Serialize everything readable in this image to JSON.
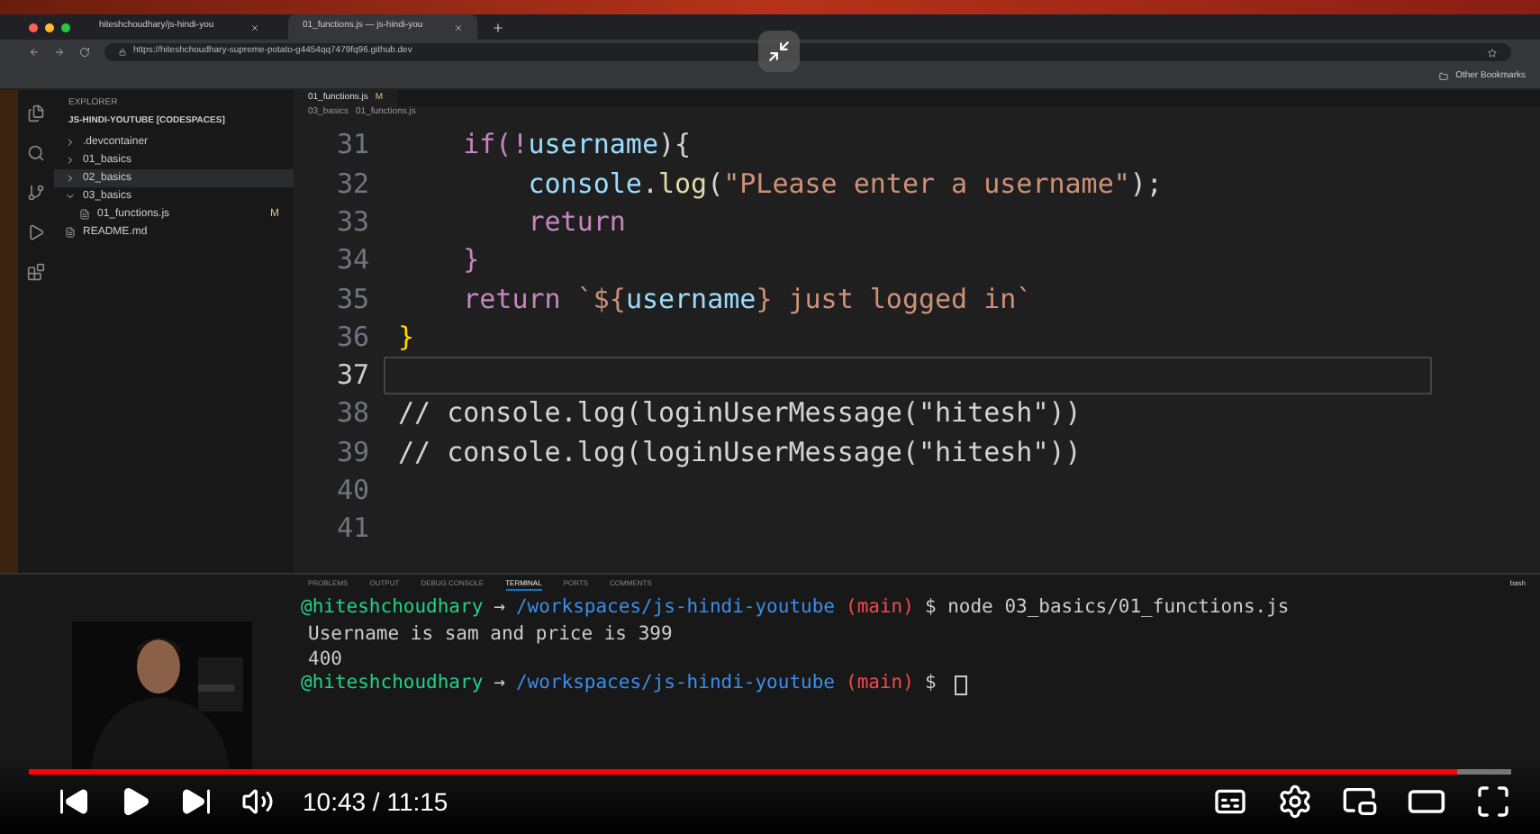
{
  "browser": {
    "tabs": [
      {
        "label": "hiteshchoudhary/js-hindi-you",
        "selected": false
      },
      {
        "label": "01_functions.js — js-hindi-you",
        "selected": true
      }
    ],
    "url": "https://hiteshchoudhary-supreme-potato-g4454qq7479fq96.github.dev",
    "bookmark": "Other Bookmarks"
  },
  "sidebar": {
    "title": "EXPLORER",
    "root": "JS-HINDI-YOUTUBE [CODESPACES]",
    "items": [
      {
        "label": ".devcontainer",
        "kind": "folder",
        "expanded": false,
        "selected": false
      },
      {
        "label": "01_basics",
        "kind": "folder",
        "expanded": false,
        "selected": false
      },
      {
        "label": "02_basics",
        "kind": "folder",
        "expanded": false,
        "selected": true
      },
      {
        "label": "03_basics",
        "kind": "folder",
        "expanded": true,
        "selected": false,
        "children": [
          {
            "label": "01_functions.js",
            "kind": "file",
            "badge": "M",
            "selected": false
          }
        ]
      },
      {
        "label": "README.md",
        "kind": "file",
        "selected": false
      }
    ]
  },
  "editor": {
    "tab": {
      "label": "01_functions.js",
      "badge": "M"
    },
    "breadcrumb": [
      "03_basics",
      "01_functions.js"
    ],
    "lines": [
      {
        "number": "31",
        "current": false,
        "tokens": [
          {
            "text": "    if(!",
            "kind": "keyword"
          },
          {
            "text": "username",
            "kind": "var"
          },
          {
            "text": "){",
            "kind": "plain"
          }
        ]
      },
      {
        "number": "32",
        "current": false,
        "tokens": [
          {
            "text": "        console",
            "kind": "var"
          },
          {
            "text": ".",
            "kind": "plain"
          },
          {
            "text": "log",
            "kind": "fn"
          },
          {
            "text": "(",
            "kind": "plain"
          },
          {
            "text": "\"PLease enter a username\"",
            "kind": "string"
          },
          {
            "text": ");",
            "kind": "plain"
          }
        ]
      },
      {
        "number": "33",
        "current": false,
        "tokens": [
          {
            "text": "        return",
            "kind": "keyword"
          }
        ]
      },
      {
        "number": "34",
        "current": false,
        "tokens": [
          {
            "text": "    }",
            "kind": "keyword"
          }
        ]
      },
      {
        "number": "35",
        "current": false,
        "tokens": [
          {
            "text": "    return ",
            "kind": "keyword"
          },
          {
            "text": "`${",
            "kind": "string"
          },
          {
            "text": "username",
            "kind": "var"
          },
          {
            "text": "} just logged in`",
            "kind": "string"
          }
        ]
      },
      {
        "number": "36",
        "current": false,
        "tokens": [
          {
            "text": "}",
            "kind": "brace"
          }
        ]
      },
      {
        "number": "37",
        "current": true
      },
      {
        "number": "38",
        "current": false,
        "tokens": [
          {
            "text": "// console.log(loginUserMessage(\"hitesh\"))",
            "kind": "comment"
          }
        ]
      },
      {
        "number": "39",
        "current": false,
        "tokens": [
          {
            "text": "// console.log(loginUserMessage(\"hitesh\"))",
            "kind": "comment"
          }
        ]
      },
      {
        "number": "40",
        "current": false
      },
      {
        "number": "41",
        "current": false
      }
    ]
  },
  "panel": {
    "tabs": [
      {
        "label": "PROBLEMS",
        "selected": false
      },
      {
        "label": "OUTPUT",
        "selected": false
      },
      {
        "label": "DEBUG CONSOLE",
        "selected": false
      },
      {
        "label": "TERMINAL",
        "selected": true
      },
      {
        "label": "PORTS",
        "selected": false
      },
      {
        "label": "COMMENTS",
        "selected": false
      }
    ],
    "shell": "bash",
    "lines": [
      {
        "kind": "prompt",
        "user": "@hiteshchoudhary",
        "arrow": "→",
        "path": "/workspaces/js-hindi-youtube",
        "branch": "(main)",
        "command": "$ node 03_basics/01_functions.js"
      },
      {
        "kind": "output",
        "text": "Username is sam and price is 399"
      },
      {
        "kind": "output",
        "text": "400"
      },
      {
        "kind": "prompt",
        "user": "@hiteshchoudhary",
        "arrow": "→",
        "path": "/workspaces/js-hindi-youtube",
        "branch": "(main)",
        "command": "$"
      }
    ]
  },
  "player": {
    "level": 0.963,
    "time": "10:43 / 11:15"
  }
}
